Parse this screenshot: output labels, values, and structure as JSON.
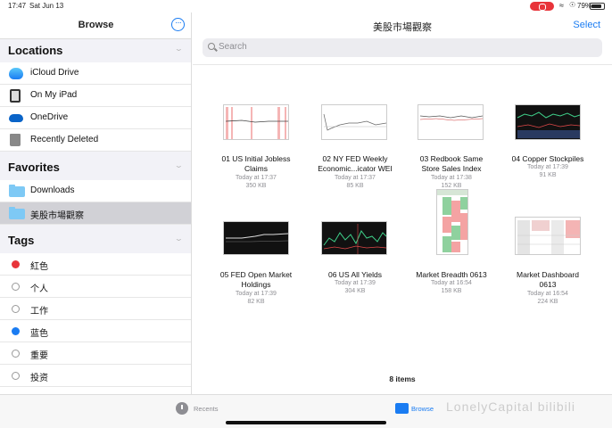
{
  "status": {
    "time": "17:47",
    "date": "Sat Jun 13",
    "battery": "79%"
  },
  "sidebar": {
    "title": "Browse",
    "locations_header": "Locations",
    "locations": [
      {
        "label": "iCloud Drive",
        "icon": "icloud-icon"
      },
      {
        "label": "On My iPad",
        "icon": "ipad-icon"
      },
      {
        "label": "OneDrive",
        "icon": "onedrive-icon"
      },
      {
        "label": "Recently Deleted",
        "icon": "trash-icon"
      }
    ],
    "favorites_header": "Favorites",
    "favorites": [
      {
        "label": "Downloads",
        "icon": "folder-icon"
      },
      {
        "label": "美股市場觀察",
        "icon": "folder-icon",
        "selected": true
      }
    ],
    "tags_header": "Tags",
    "tags": [
      {
        "label": "紅色",
        "color": "#e8343a"
      },
      {
        "label": "个人",
        "color": ""
      },
      {
        "label": "工作",
        "color": ""
      },
      {
        "label": "蓝色",
        "color": "#1a7cf2"
      },
      {
        "label": "重要",
        "color": ""
      },
      {
        "label": "投资",
        "color": ""
      }
    ]
  },
  "main": {
    "title": "美股市場觀察",
    "select_label": "Select",
    "search_placeholder": "Search",
    "items_count": "8 items",
    "files": [
      {
        "name_line1": "01 US Initial Jobless",
        "name_line2": "Claims",
        "date": "Today at 17:37",
        "size": "350 KB"
      },
      {
        "name_line1": "02 NY FED Weekly",
        "name_line2": "Economic...icator WEI",
        "date": "Today at 17:37",
        "size": "85 KB"
      },
      {
        "name_line1": "03 Redbook Same",
        "name_line2": "Store Sales Index",
        "date": "Today at 17:38",
        "size": "152 KB"
      },
      {
        "name_line1": "04 Copper Stockpiles",
        "name_line2": "",
        "date": "Today at 17:39",
        "size": "91 KB"
      },
      {
        "name_line1": "05 FED Open Market",
        "name_line2": "Holdings",
        "date": "Today at 17:39",
        "size": "82 KB"
      },
      {
        "name_line1": "06 US All Yields",
        "name_line2": "",
        "date": "Today at 17:39",
        "size": "304 KB"
      },
      {
        "name_line1": "Market Breadth 0613",
        "name_line2": "",
        "date": "Today at 16:54",
        "size": "158 KB"
      },
      {
        "name_line1": "Market Dashboard",
        "name_line2": "0613",
        "date": "Today at 16:54",
        "size": "224 KB"
      }
    ]
  },
  "tabbar": {
    "recents": "Recents",
    "browse": "Browse"
  },
  "watermark": "LonelyCapital bilibili"
}
